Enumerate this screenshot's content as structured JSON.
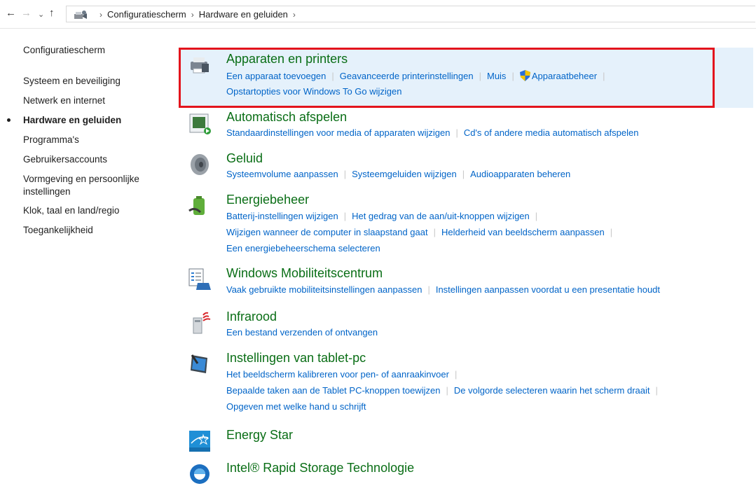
{
  "breadcrumb": [
    "Configuratiescherm",
    "Hardware en geluiden"
  ],
  "nav": {
    "home": "Configuratiescherm",
    "items": [
      {
        "label": "Systeem en beveiliging"
      },
      {
        "label": "Netwerk en internet"
      },
      {
        "label": "Hardware en geluiden",
        "current": true
      },
      {
        "label": "Programma's"
      },
      {
        "label": "Gebruikersaccounts"
      },
      {
        "label": "Vormgeving en persoonlijke"
      },
      {
        "label": "instellingen"
      },
      {
        "label": "Klok, taal en land/regio"
      },
      {
        "label": "Toegankelijkheid"
      }
    ]
  },
  "categories": [
    {
      "title": "Apparaten en printers",
      "icon": "printer-icon",
      "links": [
        "Een apparaat toevoegen",
        "Geavanceerde printerinstellingen",
        "Muis",
        "Apparaatbeheer",
        "Opstartopties voor Windows To Go wijzigen"
      ]
    },
    {
      "title": "Automatisch afspelen",
      "icon": "autoplay-icon",
      "links": [
        "Standaardinstellingen voor media of apparaten wijzigen",
        "Cd's of andere media automatisch afspelen"
      ]
    },
    {
      "title": "Geluid",
      "icon": "speaker-icon",
      "links": [
        "Systeemvolume aanpassen",
        "Systeemgeluiden wijzigen",
        "Audioapparaten beheren"
      ]
    },
    {
      "title": "Energiebeheer",
      "icon": "battery-icon",
      "links": [
        "Batterij-instellingen wijzigen",
        "Het gedrag van de aan/uit-knoppen wijzigen",
        "Wijzigen wanneer de computer in slaapstand gaat",
        "Helderheid van beeldscherm aanpassen",
        "Een energiebeheerschema selecteren"
      ]
    },
    {
      "title": "Windows Mobiliteitscentrum",
      "icon": "mobility-center-icon",
      "links": [
        "Vaak gebruikte mobiliteitsinstellingen aanpassen",
        "Instellingen aanpassen voordat u een presentatie houdt"
      ]
    },
    {
      "title": "Infrarood",
      "icon": "infrared-icon",
      "links": [
        "Een bestand verzenden of ontvangen"
      ]
    },
    {
      "title": "Instellingen van tablet-pc",
      "icon": "tablet-icon",
      "links": [
        "Het beeldscherm kalibreren voor pen- of aanraakinvoer",
        "Bepaalde taken aan de Tablet PC-knoppen toewijzen",
        "De volgorde selecteren waarin het scherm draait",
        "Opgeven met welke hand u schrijft"
      ]
    },
    {
      "title": "Energy Star",
      "icon": "energy-star-icon",
      "links": []
    },
    {
      "title": "Intel® Rapid Storage Technologie",
      "icon": "intel-rst-icon",
      "links": []
    }
  ]
}
